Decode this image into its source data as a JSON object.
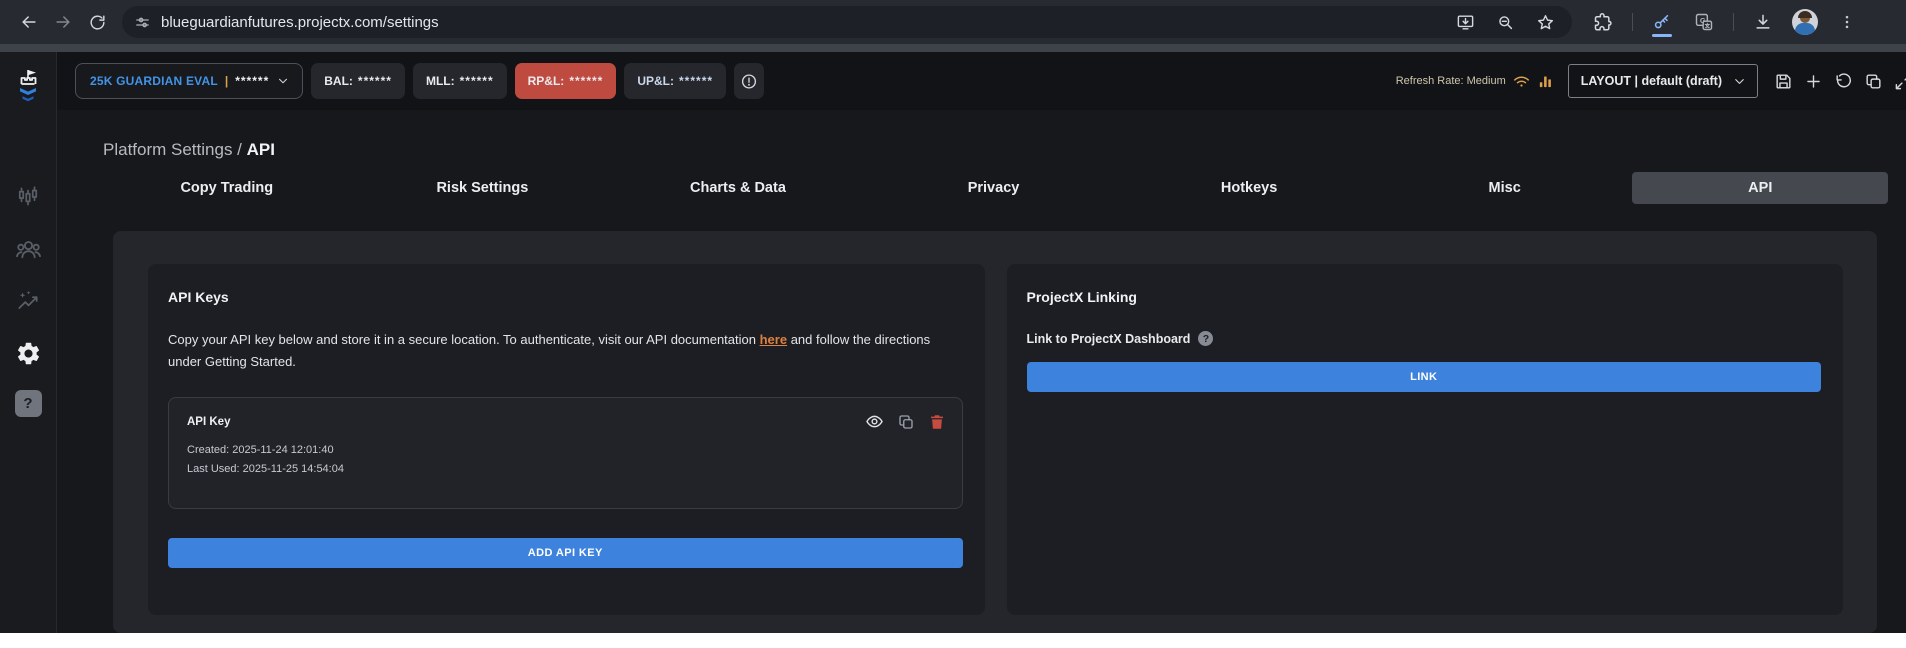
{
  "browser": {
    "url": "blueguardianfutures.projectx.com/settings"
  },
  "header": {
    "account_selector": {
      "name": "25K GUARDIAN EVAL",
      "divider": "|",
      "masked": "******"
    },
    "stats": [
      {
        "label": "BAL:",
        "value": "******"
      },
      {
        "label": "MLL:",
        "value": "******"
      },
      {
        "label": "RP&L:",
        "value": "******"
      },
      {
        "label": "UP&L:",
        "value": "******"
      }
    ],
    "refresh_rate_label": "Refresh Rate: Medium",
    "layout_label": "LAYOUT | default (draft)"
  },
  "breadcrumb": {
    "section": "Platform Settings",
    "separator": " / ",
    "current": "API"
  },
  "tabs": [
    {
      "label": "Copy Trading"
    },
    {
      "label": "Risk Settings"
    },
    {
      "label": "Charts & Data"
    },
    {
      "label": "Privacy"
    },
    {
      "label": "Hotkeys"
    },
    {
      "label": "Misc"
    },
    {
      "label": "API"
    }
  ],
  "api_keys_card": {
    "title": "API Keys",
    "description_before_link": "Copy your API key below and store it in a secure location. To authenticate, visit our API documentation ",
    "link_text": "here",
    "description_after_link": " and follow the directions under Getting Started.",
    "key_entry": {
      "label": "API Key",
      "created": "Created: 2025-11-24 12:01:40",
      "last_used": "Last Used: 2025-11-25 14:54:04"
    },
    "add_button_label": "ADD API KEY"
  },
  "projectx_card": {
    "title": "ProjectX Linking",
    "link_row_label": "Link to ProjectX Dashboard",
    "help_badge": "?",
    "link_button_label": "LINK"
  },
  "colors": {
    "accent_blue": "#3d82dd",
    "danger_red": "#bf4b40",
    "warning_orange": "#dfa04a",
    "link_orange": "#de813e",
    "account_blue": "#4394e6",
    "active_tab_gray": "#45484e"
  }
}
